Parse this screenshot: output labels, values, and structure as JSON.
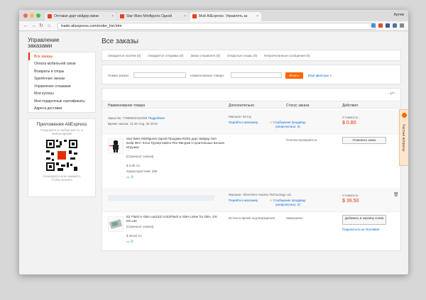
{
  "browser": {
    "tabs": [
      {
        "title": "Оптовая дарт вейдер мини"
      },
      {
        "title": "Star Wars Minifigures Одной"
      },
      {
        "title": "Мой AliExpress: Управлять за"
      }
    ],
    "user": "Артем",
    "url": "trade.aliexpress.com/order_list.htm"
  },
  "sidebar": {
    "title_line1": "Управление",
    "title_line2": "заказами",
    "items": [
      {
        "label": "Все заказы"
      },
      {
        "label": "Оплата мобильной связи"
      },
      {
        "label": "Возвраты и споры"
      },
      {
        "label": "Удалённые заказы"
      },
      {
        "label": "Управление отзывами"
      },
      {
        "label": "Мои купоны"
      },
      {
        "label": "Мои подарочные сертификаты"
      },
      {
        "label": "Адреса доставки"
      }
    ],
    "apps": {
      "title": "Приложения AliExpress",
      "subtitle": "Покупайте в любом месте, в любое время!",
      "caption": "Сканируйте или нажмите, чтобы скачать"
    }
  },
  "main": {
    "title": "Все заказы",
    "status_tabs": [
      {
        "label": "Ожидается платёж (0)"
      },
      {
        "label": "Ожидается отправка (0)"
      },
      {
        "label": "Заказ отправлен (0)"
      },
      {
        "label": "Открытые споры (0)"
      },
      {
        "label": "Непрочитанные сообщения (0)"
      }
    ],
    "filter": {
      "order_no_label": "Номер заказа:",
      "product_label": "Наименование товара:",
      "search_button": "Искать",
      "more_filters": "Ещё фильтры ˅"
    },
    "pager": "‹ 1/7 ›",
    "headers": {
      "product": "Наименование товара",
      "extra": "Дополнительно",
      "status": "Статус заказа",
      "action": "Действия"
    },
    "order1": {
      "order_no": "Заказ №: 77889522162459",
      "details_link": "Подробнее",
      "time": "Время заказа: 11:46 Aug. 26 2016",
      "shop": "Магазин: 94 toy",
      "goto_shop": "Перейти к магазину",
      "msg": "Сообщение продавцу",
      "unread": "(непрочитано: 0)",
      "cost_label": "Стоимость:",
      "cost": "$ 0.80",
      "product_title": "Star Wars Minifigures Одной Продажи R2D2 дарт вейдер Лея Боба Фетт Клон Трупер Кайло Рен Фигурки Строительных Блоков Игрушки",
      "snapshot": "[Скриншот заказа]",
      "price": "$ 0.80 X1",
      "prop": "Характеристики: 385",
      "status": "Платёж проверяется",
      "action": "Отменить заказ"
    },
    "order2": {
      "shop": "Магазин: Shenzhen HuaXiu Technology Ltd.",
      "goto_shop": "Перейти к магазину",
      "msg": "Сообщение продавцу",
      "unread": "(непрочитано: 0)",
      "cost_label": "Стоимость:",
      "cost": "$ 39.50",
      "product_title": "EZ Flash iv GBA card,EZ IV,EZFlash iv GBA Linker for GBA, DS, DS Lite",
      "snapshot": "[Скриншот заказа]",
      "price": "$ 39.50 X1",
      "extra_status": "Истекло время подтверждения",
      "status": "Завершено",
      "action": "Добавить в корзину снова",
      "share": "Поделиться на Vkontakte"
    }
  },
  "help_tab": "Частые вопросы"
}
